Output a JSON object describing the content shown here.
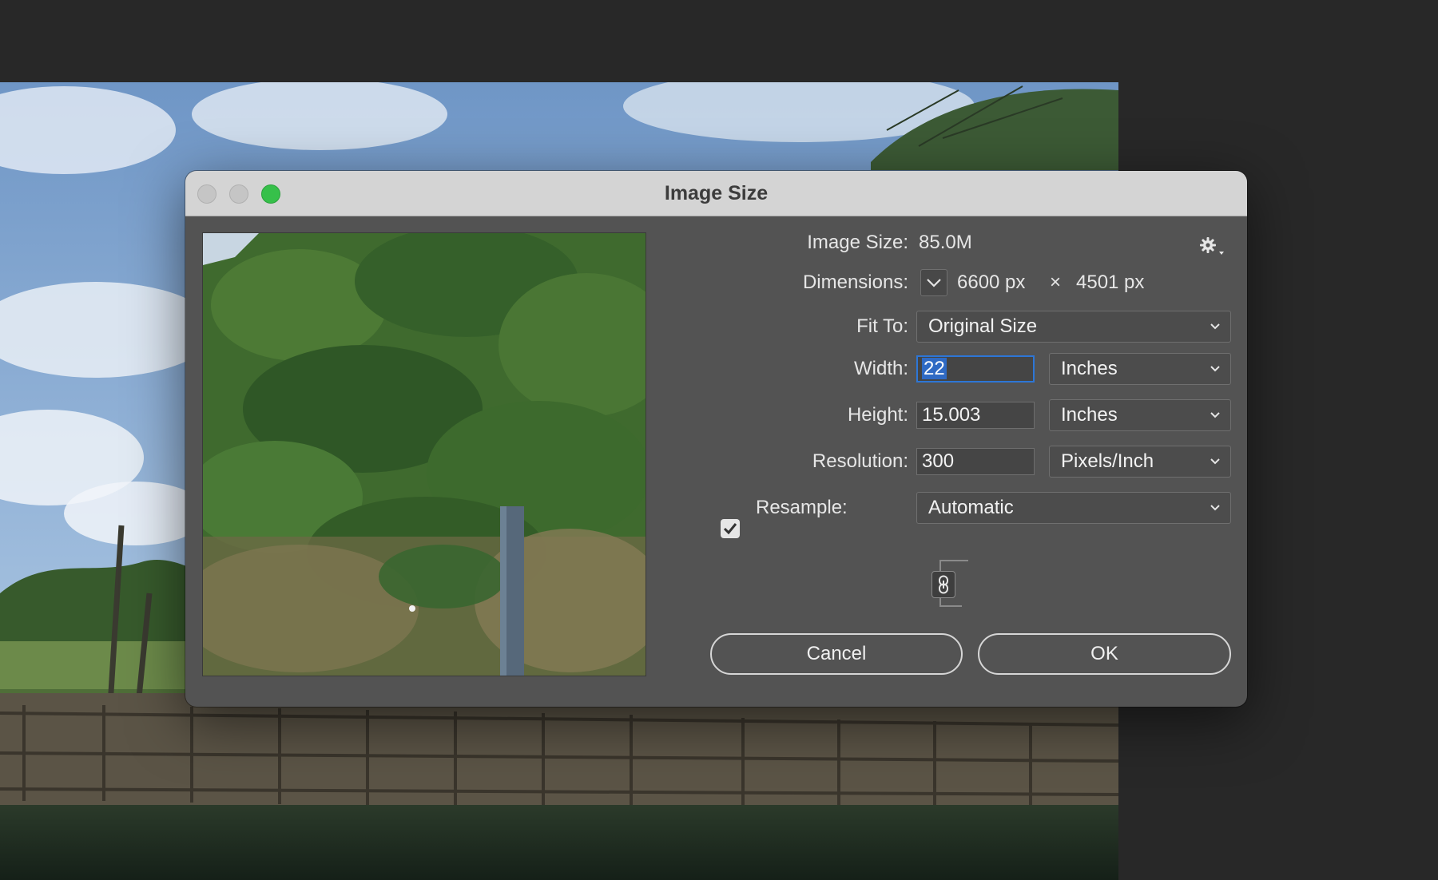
{
  "dialog": {
    "title": "Image Size",
    "image_size_label": "Image Size:",
    "image_size_value": "85.0M",
    "dimensions_label": "Dimensions:",
    "dimensions_width": "6600 px",
    "dimensions_sep": "×",
    "dimensions_height": "4501 px",
    "fit_to_label": "Fit To:",
    "fit_to_value": "Original Size",
    "width_label": "Width:",
    "width_value": "22",
    "width_unit": "Inches",
    "height_label": "Height:",
    "height_value": "15.003",
    "height_unit": "Inches",
    "resolution_label": "Resolution:",
    "resolution_value": "300",
    "resolution_unit": "Pixels/Inch",
    "resample_label": "Resample:",
    "resample_checked": true,
    "resample_value": "Automatic",
    "cancel_label": "Cancel",
    "ok_label": "OK"
  },
  "colors": {
    "accent_focus": "#2d76d6",
    "zoom_button": "#36c04a",
    "dialog_bg": "#535353",
    "titlebar_bg": "#d4d4d4"
  },
  "icons": [
    "gear-icon",
    "chevron-down-icon",
    "link-chain-icon",
    "checkmark-icon"
  ]
}
